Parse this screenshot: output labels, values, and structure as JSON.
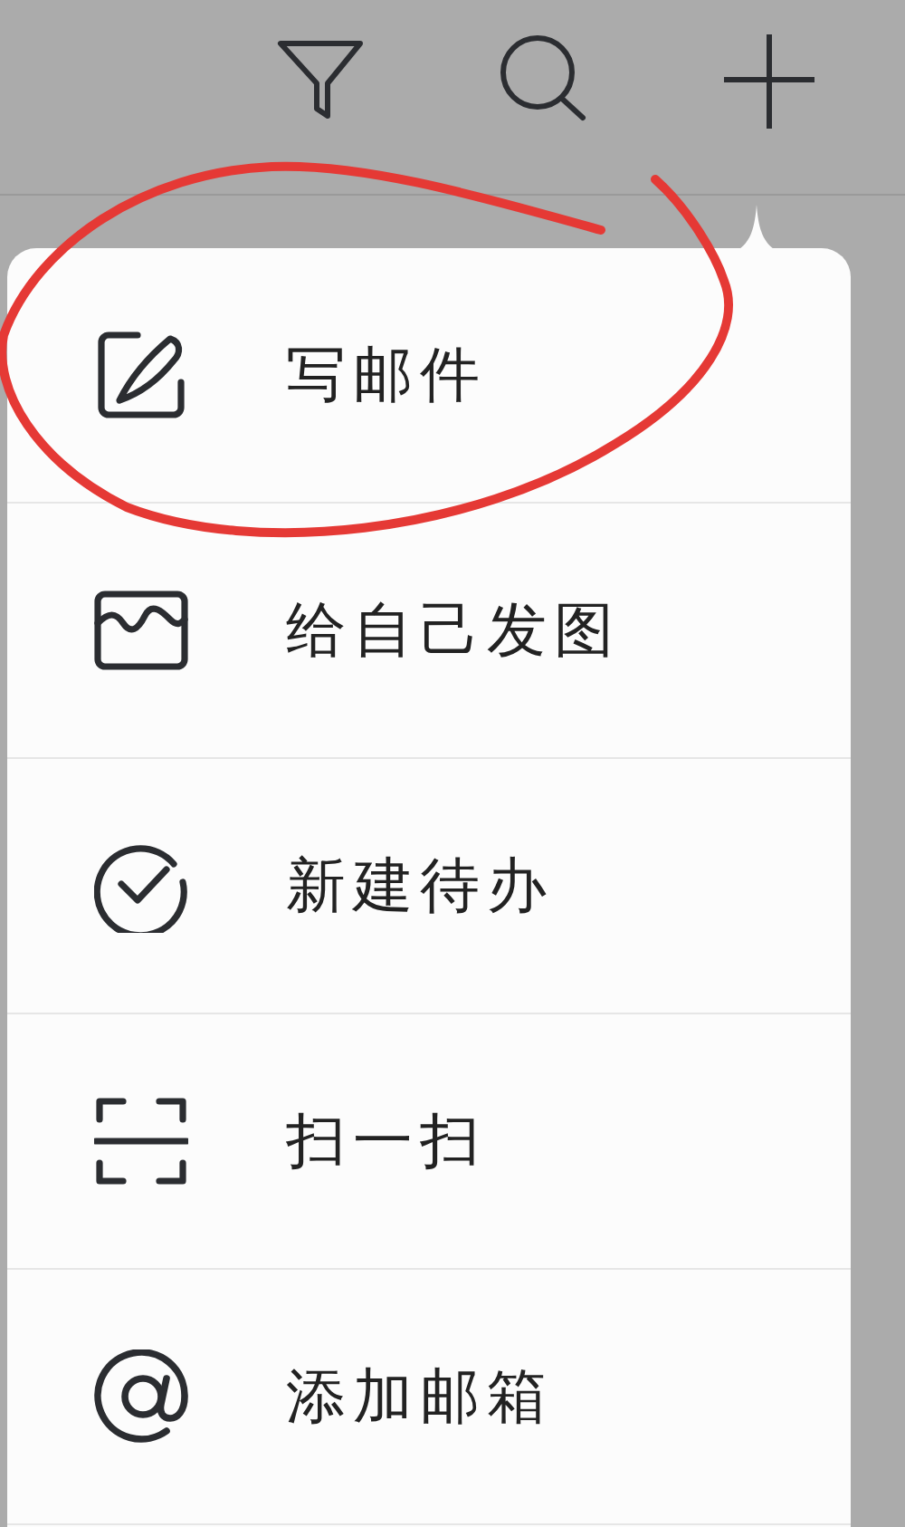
{
  "menu": {
    "items": [
      {
        "label": "写邮件"
      },
      {
        "label": "给自己发图"
      },
      {
        "label": "新建待办"
      },
      {
        "label": "扫一扫"
      },
      {
        "label": "添加邮箱"
      }
    ]
  }
}
